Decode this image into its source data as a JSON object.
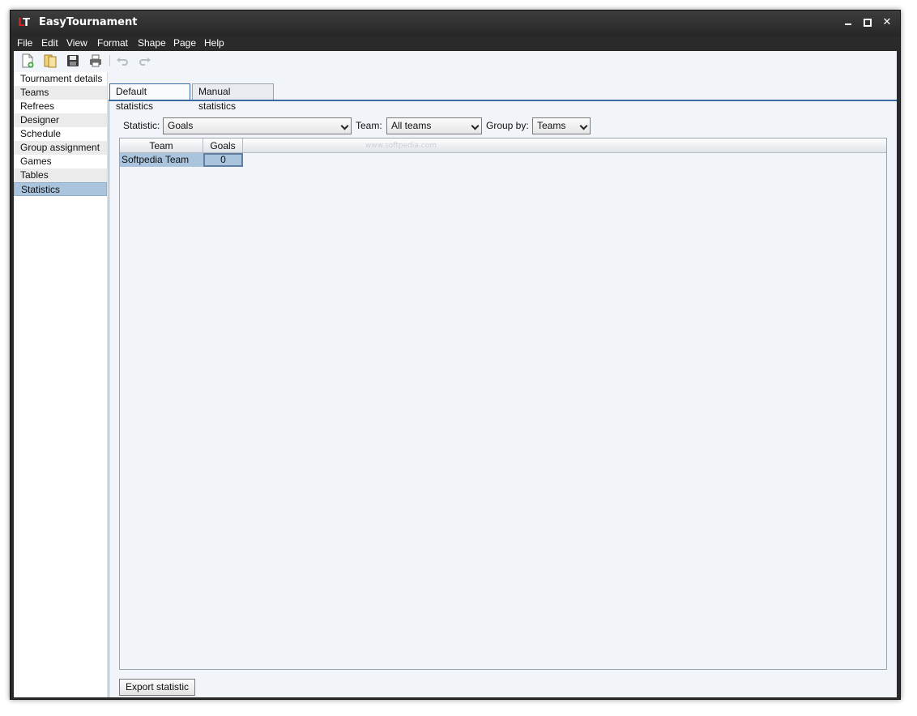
{
  "window": {
    "title": "EasyTournament"
  },
  "menu": [
    "File",
    "Edit",
    "View",
    "Format",
    "Shape",
    "Page",
    "Help"
  ],
  "toolbar": {
    "buttons": [
      "new-icon",
      "open-icon",
      "save-icon",
      "print-icon",
      "undo-icon",
      "redo-icon"
    ]
  },
  "sidebar": {
    "items": [
      {
        "label": "Tournament details"
      },
      {
        "label": "Teams"
      },
      {
        "label": "Refrees"
      },
      {
        "label": "Designer"
      },
      {
        "label": "Schedule"
      },
      {
        "label": "Group assignment"
      },
      {
        "label": "Games"
      },
      {
        "label": "Tables"
      },
      {
        "label": "Statistics"
      }
    ],
    "selected": "Statistics"
  },
  "tabs": [
    {
      "label": "Default statistics",
      "active": true
    },
    {
      "label": "Manual statistics",
      "active": false
    }
  ],
  "filters": {
    "statistic_label": "Statistic:",
    "statistic_value": "Goals",
    "team_label": "Team:",
    "team_value": "All teams",
    "groupby_label": "Group by:",
    "groupby_value": "Teams"
  },
  "table": {
    "columns": [
      "Team",
      "Goals"
    ],
    "rows": [
      {
        "team": "Softpedia Team",
        "goals": "0"
      }
    ]
  },
  "export_label": "Export statistic",
  "watermark": "www.softpedia.com",
  "colors": {
    "selection": "#a9c4dc",
    "accent": "#3b6aa0",
    "titlebar": "#2a2a2a",
    "logo_red": "#e02020"
  }
}
